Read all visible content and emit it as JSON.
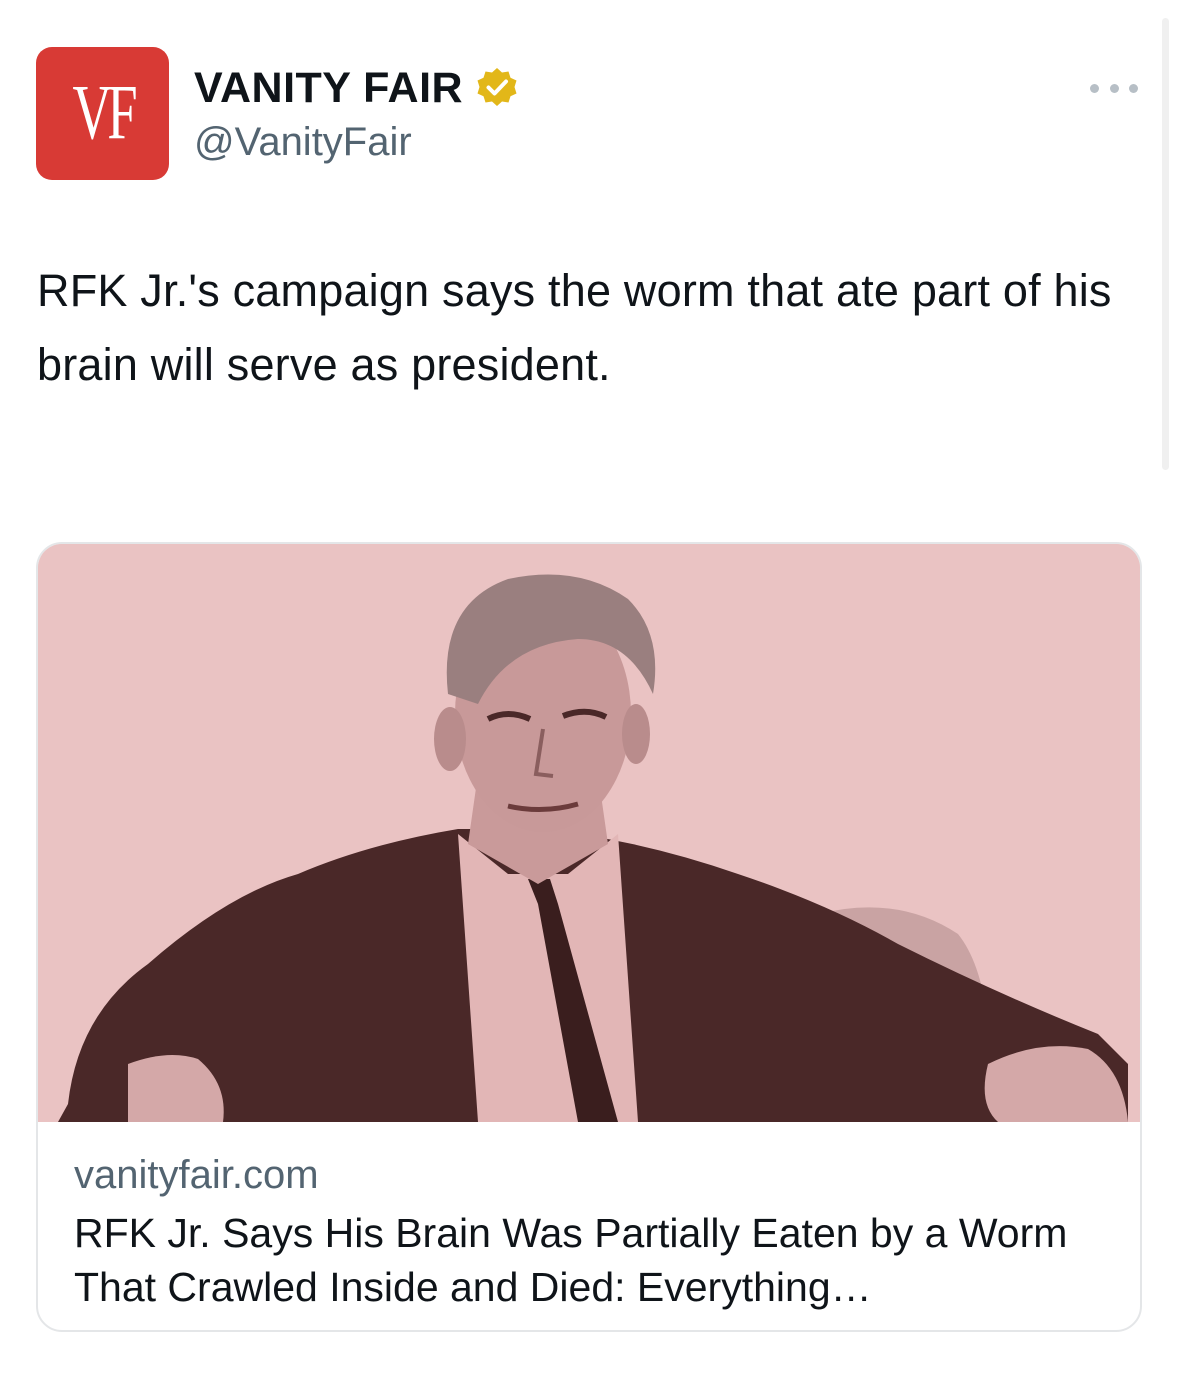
{
  "account": {
    "avatar_text": "VF",
    "display_name": "VANITY FAIR",
    "handle": "@VanityFair",
    "verified_badge_icon": "gold-verified-badge-icon",
    "avatar_color": "#d83a35",
    "badge_color": "#e2b719"
  },
  "menu": {
    "more_icon": "more-horizontal-icon"
  },
  "tweet": {
    "text": "RFK Jr.'s campaign says the worm that ate part of his brain will serve as president."
  },
  "link_card": {
    "image_icon": "article-photo",
    "image_tint": "#eac3c3",
    "domain": "vanityfair.com",
    "title": "RFK Jr. Says His Brain Was Partially Eaten by a Worm That Crawled Inside and Died: Everything…"
  }
}
